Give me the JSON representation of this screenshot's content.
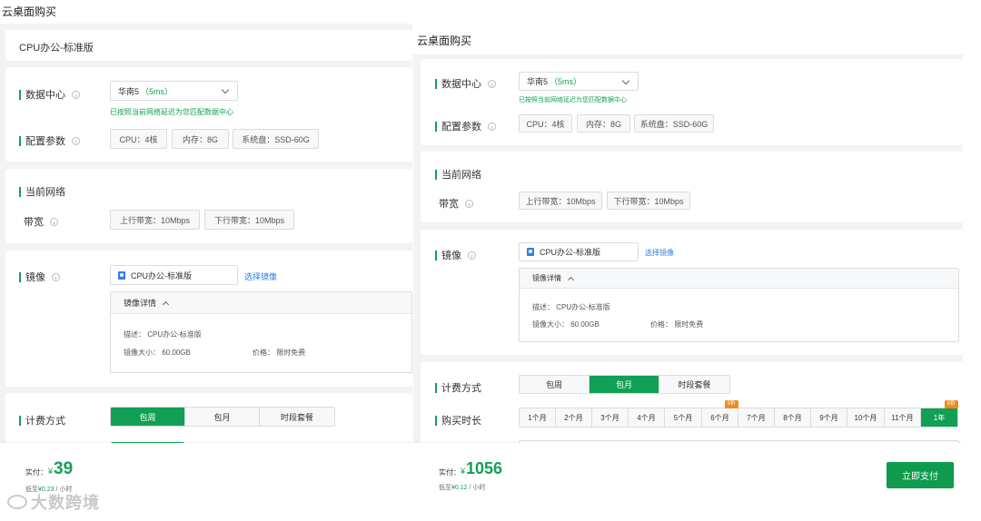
{
  "left": {
    "title": "云桌面购买",
    "product": "CPU办公-标准版",
    "datacenter_label": "数据中心",
    "region": "华南5",
    "latency": "（5ms）",
    "hint": "已按照当前网络延迟为您匹配数据中心",
    "config_label": "配置参数",
    "config_tags": [
      "CPU：4核",
      "内存：8G",
      "系统盘：SSD-60G"
    ],
    "network_label": "当前网络",
    "bandwidth_label": "带宽",
    "bandwidth_tags": [
      "上行带宽：10Mbps",
      "下行带宽：10Mbps"
    ],
    "image_label": "镜像",
    "image_name": "CPU办公-标准版",
    "select_image": "选择镜像",
    "detail_title": "镜像详情",
    "detail_desc": "描述：  CPU办公-标准版",
    "detail_size": "镜像大小：  60.00GB",
    "detail_price": "价格：  限时免费",
    "billing_label": "计费方式",
    "billing_options": [
      "包周",
      "包月",
      "时段套餐"
    ],
    "billing_selected": 0,
    "pay_label": "实付：",
    "currency": "¥",
    "price": "39",
    "low_prefix": "低至",
    "low_value": "¥0.23",
    "low_suffix": " / 小时"
  },
  "right": {
    "title": "云桌面购买",
    "datacenter_label": "数据中心",
    "region": "华南5",
    "latency": "（5ms）",
    "hint": "已按照当前网络延迟为您匹配数据中心",
    "config_label": "配置参数",
    "config_tags": [
      "CPU：4核",
      "内存：8G",
      "系统盘：SSD-60G"
    ],
    "network_label": "当前网络",
    "bandwidth_label": "带宽",
    "bandwidth_tags": [
      "上行带宽：10Mbps",
      "下行带宽：10Mbps"
    ],
    "image_label": "镜像",
    "image_name": "CPU办公-标准版",
    "select_image": "选择镜像",
    "detail_title": "镜像详情",
    "detail_desc": "描述：  CPU办公-标准版",
    "detail_size": "镜像大小：  60.00GB",
    "detail_price": "价格：  限时免费",
    "billing_label": "计费方式",
    "billing_options": [
      "包周",
      "包月",
      "时段套餐"
    ],
    "billing_selected": 1,
    "duration_label": "购买时长",
    "months": [
      "1个月",
      "2个月",
      "3个月",
      "4个月",
      "5个月",
      "6个月",
      "7个月",
      "8个月",
      "9个月",
      "10个月",
      "11个月",
      "1年"
    ],
    "month_badges": {
      "5": "9折",
      "11": "8折"
    },
    "month_selected": 11,
    "pay_label": "实付：",
    "currency": "¥",
    "price": "1056",
    "low_prefix": "低至",
    "low_value": "¥0.12",
    "low_suffix": " / 小时",
    "pay_button": "立即支付"
  },
  "watermark": "大数跨境",
  "colors": {
    "accent": "#12a055",
    "link": "#2c7ee6",
    "badge": "#f08a1c",
    "pay_button": "#0f9a4c"
  }
}
